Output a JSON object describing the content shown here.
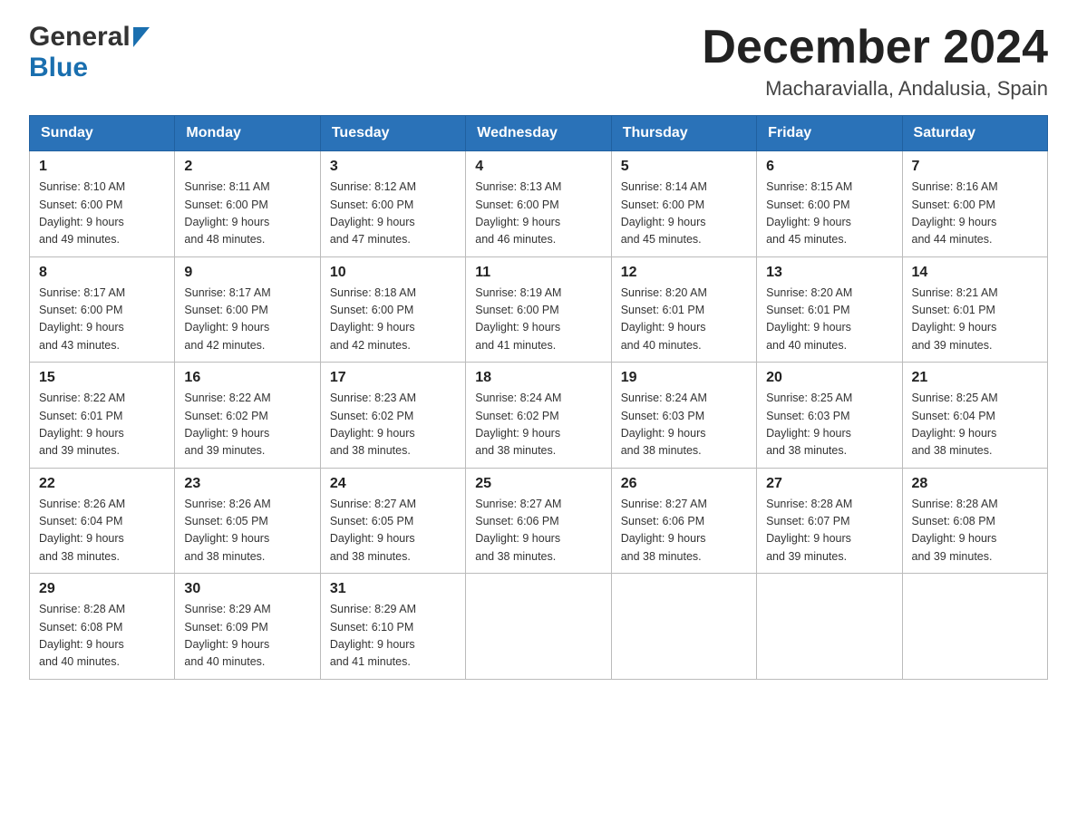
{
  "header": {
    "logo_general": "General",
    "logo_blue": "Blue",
    "title": "December 2024",
    "subtitle": "Macharavialla, Andalusia, Spain"
  },
  "days_of_week": [
    "Sunday",
    "Monday",
    "Tuesday",
    "Wednesday",
    "Thursday",
    "Friday",
    "Saturday"
  ],
  "weeks": [
    [
      {
        "day": "1",
        "sunrise": "8:10 AM",
        "sunset": "6:00 PM",
        "daylight": "9 hours and 49 minutes."
      },
      {
        "day": "2",
        "sunrise": "8:11 AM",
        "sunset": "6:00 PM",
        "daylight": "9 hours and 48 minutes."
      },
      {
        "day": "3",
        "sunrise": "8:12 AM",
        "sunset": "6:00 PM",
        "daylight": "9 hours and 47 minutes."
      },
      {
        "day": "4",
        "sunrise": "8:13 AM",
        "sunset": "6:00 PM",
        "daylight": "9 hours and 46 minutes."
      },
      {
        "day": "5",
        "sunrise": "8:14 AM",
        "sunset": "6:00 PM",
        "daylight": "9 hours and 45 minutes."
      },
      {
        "day": "6",
        "sunrise": "8:15 AM",
        "sunset": "6:00 PM",
        "daylight": "9 hours and 45 minutes."
      },
      {
        "day": "7",
        "sunrise": "8:16 AM",
        "sunset": "6:00 PM",
        "daylight": "9 hours and 44 minutes."
      }
    ],
    [
      {
        "day": "8",
        "sunrise": "8:17 AM",
        "sunset": "6:00 PM",
        "daylight": "9 hours and 43 minutes."
      },
      {
        "day": "9",
        "sunrise": "8:17 AM",
        "sunset": "6:00 PM",
        "daylight": "9 hours and 42 minutes."
      },
      {
        "day": "10",
        "sunrise": "8:18 AM",
        "sunset": "6:00 PM",
        "daylight": "9 hours and 42 minutes."
      },
      {
        "day": "11",
        "sunrise": "8:19 AM",
        "sunset": "6:00 PM",
        "daylight": "9 hours and 41 minutes."
      },
      {
        "day": "12",
        "sunrise": "8:20 AM",
        "sunset": "6:01 PM",
        "daylight": "9 hours and 40 minutes."
      },
      {
        "day": "13",
        "sunrise": "8:20 AM",
        "sunset": "6:01 PM",
        "daylight": "9 hours and 40 minutes."
      },
      {
        "day": "14",
        "sunrise": "8:21 AM",
        "sunset": "6:01 PM",
        "daylight": "9 hours and 39 minutes."
      }
    ],
    [
      {
        "day": "15",
        "sunrise": "8:22 AM",
        "sunset": "6:01 PM",
        "daylight": "9 hours and 39 minutes."
      },
      {
        "day": "16",
        "sunrise": "8:22 AM",
        "sunset": "6:02 PM",
        "daylight": "9 hours and 39 minutes."
      },
      {
        "day": "17",
        "sunrise": "8:23 AM",
        "sunset": "6:02 PM",
        "daylight": "9 hours and 38 minutes."
      },
      {
        "day": "18",
        "sunrise": "8:24 AM",
        "sunset": "6:02 PM",
        "daylight": "9 hours and 38 minutes."
      },
      {
        "day": "19",
        "sunrise": "8:24 AM",
        "sunset": "6:03 PM",
        "daylight": "9 hours and 38 minutes."
      },
      {
        "day": "20",
        "sunrise": "8:25 AM",
        "sunset": "6:03 PM",
        "daylight": "9 hours and 38 minutes."
      },
      {
        "day": "21",
        "sunrise": "8:25 AM",
        "sunset": "6:04 PM",
        "daylight": "9 hours and 38 minutes."
      }
    ],
    [
      {
        "day": "22",
        "sunrise": "8:26 AM",
        "sunset": "6:04 PM",
        "daylight": "9 hours and 38 minutes."
      },
      {
        "day": "23",
        "sunrise": "8:26 AM",
        "sunset": "6:05 PM",
        "daylight": "9 hours and 38 minutes."
      },
      {
        "day": "24",
        "sunrise": "8:27 AM",
        "sunset": "6:05 PM",
        "daylight": "9 hours and 38 minutes."
      },
      {
        "day": "25",
        "sunrise": "8:27 AM",
        "sunset": "6:06 PM",
        "daylight": "9 hours and 38 minutes."
      },
      {
        "day": "26",
        "sunrise": "8:27 AM",
        "sunset": "6:06 PM",
        "daylight": "9 hours and 38 minutes."
      },
      {
        "day": "27",
        "sunrise": "8:28 AM",
        "sunset": "6:07 PM",
        "daylight": "9 hours and 39 minutes."
      },
      {
        "day": "28",
        "sunrise": "8:28 AM",
        "sunset": "6:08 PM",
        "daylight": "9 hours and 39 minutes."
      }
    ],
    [
      {
        "day": "29",
        "sunrise": "8:28 AM",
        "sunset": "6:08 PM",
        "daylight": "9 hours and 40 minutes."
      },
      {
        "day": "30",
        "sunrise": "8:29 AM",
        "sunset": "6:09 PM",
        "daylight": "9 hours and 40 minutes."
      },
      {
        "day": "31",
        "sunrise": "8:29 AM",
        "sunset": "6:10 PM",
        "daylight": "9 hours and 41 minutes."
      },
      null,
      null,
      null,
      null
    ]
  ],
  "labels": {
    "sunrise": "Sunrise:",
    "sunset": "Sunset:",
    "daylight": "Daylight:"
  }
}
